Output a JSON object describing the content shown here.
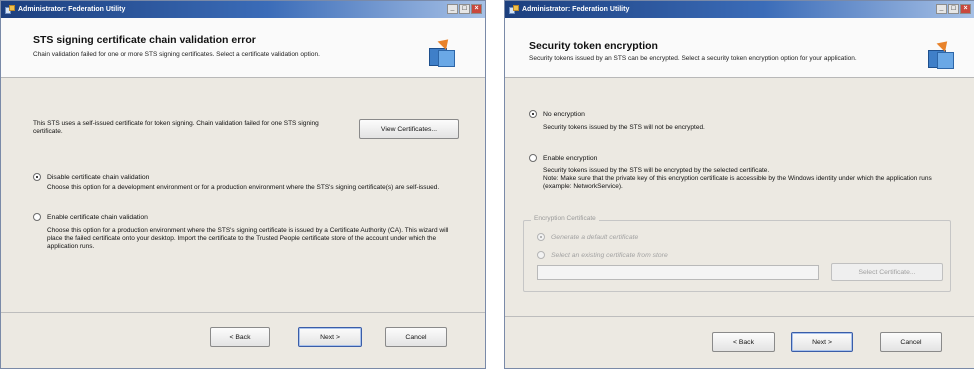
{
  "left_window": {
    "title": "Administrator: Federation Utility",
    "window_buttons": [
      "_",
      "□",
      "×"
    ],
    "header_title": "STS signing certificate chain validation error",
    "header_subtitle": "Chain validation failed for one or more STS signing certificates. Select a certificate validation option.",
    "intro_text": "This STS uses a self-issued certificate for token signing. Chain validation failed for one STS signing certificate.",
    "view_certificates_button": "View Certificates...",
    "option1_label": "Disable certificate chain validation",
    "option1_desc": "Choose this option for a development environment or for a production environment where the STS's signing certificate(s) are self-issued.",
    "option2_label": "Enable certificate chain validation",
    "option2_desc": "Choose this option for a production environment where the STS's signing certificate is issued by a Certificate Authority (CA). This wizard will place the failed certificate onto your desktop. Import the certificate to the Trusted People certificate store of the account under which the application runs.",
    "back_button": "< Back",
    "next_button": "Next >",
    "cancel_button": "Cancel"
  },
  "right_window": {
    "title": "Administrator: Federation Utility",
    "window_buttons": [
      "_",
      "□",
      "×"
    ],
    "header_title": "Security token encryption",
    "header_subtitle": "Security tokens issued by an STS can be encrypted. Select a security token encryption option for your application.",
    "option1_label": "No encryption",
    "option1_desc": "Security tokens issued by the STS will not be encrypted.",
    "option2_label": "Enable encryption",
    "option2_desc": "Security tokens issued by the STS will be encrypted by the selected certificate.",
    "option2_note": "Note: Make sure that the private key of this encryption certificate is accessible by the Windows identity under which the application runs (example: NetworkService).",
    "group_title": "Encryption Certificate",
    "generate_label": "Generate a default certificate",
    "select_existing_label": "Select an existing certificate from store",
    "certificate_path_value": "",
    "select_certificate_button": "Select Certificate...",
    "back_button": "< Back",
    "next_button": "Next >",
    "cancel_button": "Cancel"
  }
}
